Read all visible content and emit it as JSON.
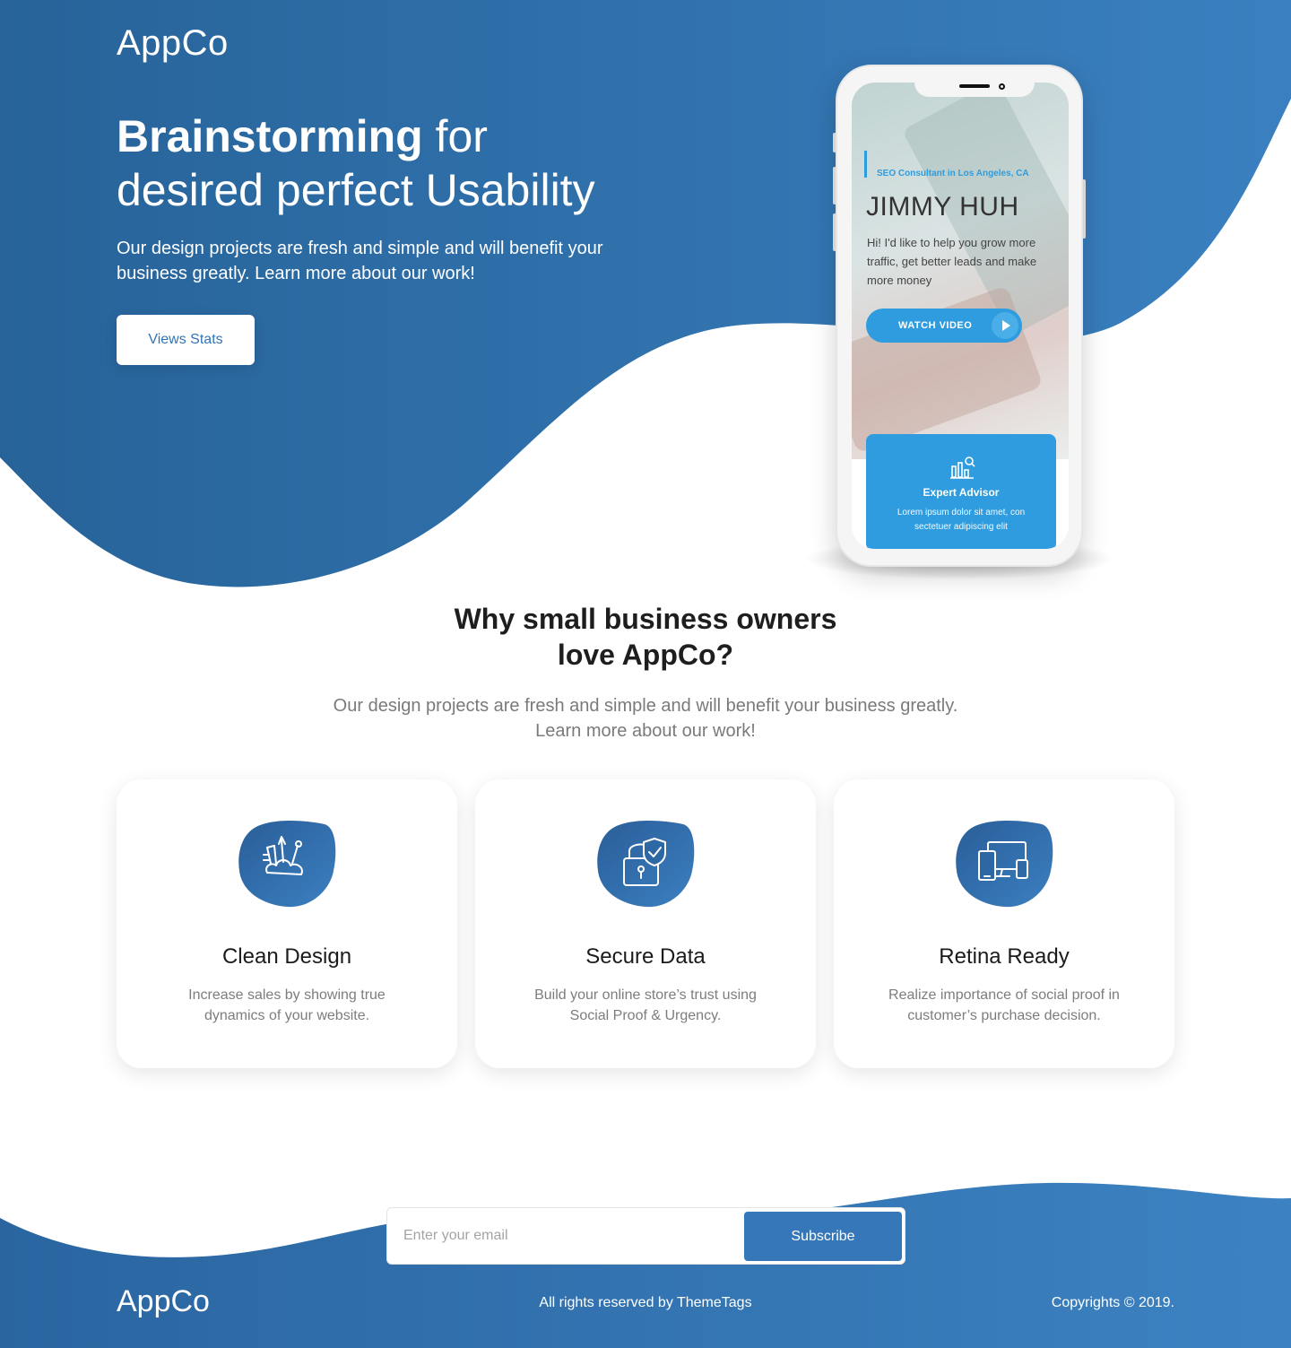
{
  "brand": {
    "name": "AppCo",
    "primary_color": "#2a6aa6",
    "accent_color": "#2e9cde"
  },
  "hero": {
    "title_bold": "Brainstorming",
    "title_rest": " for",
    "title_line2": "desired perfect Usability",
    "subtitle": "Our design projects are fresh and simple and will benefit your business greatly. Learn more about our work!",
    "button_label": "Views Stats"
  },
  "phone_screen": {
    "tag": "SEO Consultant in Los Angeles, CA",
    "name": "JIMMY HUH",
    "text": "Hi! I'd like to help you grow more traffic, get better leads and make more money",
    "button_label": "WATCH VIDEO",
    "card_title": "Expert Advisor",
    "card_desc": "Lorem ipsum dolor sit amet, con sectetuer adipiscing elit"
  },
  "why": {
    "title_part1": "Why ",
    "title_bold1": "small business owners",
    "title_bold2": "love",
    "title_part2": " AppCo?",
    "subtitle": "Our design projects are fresh and simple and will benefit your business greatly. Learn more about our work!"
  },
  "features": [
    {
      "icon": "design-tools-icon",
      "title": "Clean Design",
      "desc": "Increase sales by showing true dynamics of your website."
    },
    {
      "icon": "secure-lock-icon",
      "title": "Secure Data",
      "desc": "Build your online store’s trust using Social Proof & Urgency."
    },
    {
      "icon": "devices-icon",
      "title": "Retina Ready",
      "desc": "Realize importance of social proof in customer’s purchase decision."
    }
  ],
  "subscribe": {
    "placeholder": "Enter your email",
    "button_label": "Subscribe"
  },
  "footer": {
    "logo": "AppCo",
    "rights": "All rights reserved by ThemeTags",
    "copyright": "Copyrights © 2019."
  }
}
